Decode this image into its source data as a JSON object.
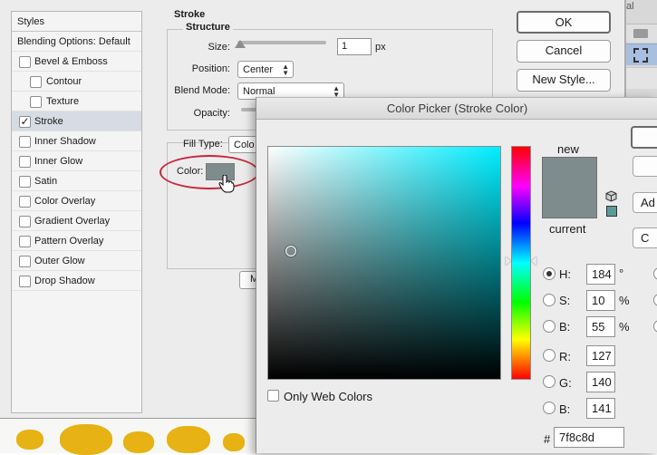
{
  "styles_panel": {
    "header": "Styles",
    "blending_options": "Blending Options: Default",
    "items": [
      {
        "label": "Bevel & Emboss",
        "checked": false,
        "indent": false,
        "selected": false
      },
      {
        "label": "Contour",
        "checked": false,
        "indent": true,
        "selected": false
      },
      {
        "label": "Texture",
        "checked": false,
        "indent": true,
        "selected": false
      },
      {
        "label": "Stroke",
        "checked": true,
        "indent": false,
        "selected": true
      },
      {
        "label": "Inner Shadow",
        "checked": false,
        "indent": false,
        "selected": false
      },
      {
        "label": "Inner Glow",
        "checked": false,
        "indent": false,
        "selected": false
      },
      {
        "label": "Satin",
        "checked": false,
        "indent": false,
        "selected": false
      },
      {
        "label": "Color Overlay",
        "checked": false,
        "indent": false,
        "selected": false
      },
      {
        "label": "Gradient Overlay",
        "checked": false,
        "indent": false,
        "selected": false
      },
      {
        "label": "Pattern Overlay",
        "checked": false,
        "indent": false,
        "selected": false
      },
      {
        "label": "Outer Glow",
        "checked": false,
        "indent": false,
        "selected": false
      },
      {
        "label": "Drop Shadow",
        "checked": false,
        "indent": false,
        "selected": false
      }
    ]
  },
  "stroke": {
    "title": "Stroke",
    "structure_title": "Structure",
    "size_label": "Size:",
    "size_value": "1",
    "size_unit": "px",
    "position_label": "Position:",
    "position_value": "Center",
    "blend_mode_label": "Blend Mode:",
    "blend_mode_value": "Normal",
    "opacity_label": "Opacity:",
    "fill_type_label": "Fill Type:",
    "fill_type_value": "Colo",
    "color_label": "Color:",
    "color_swatch": "#7f8c8d",
    "annotation_color": "#c8283a",
    "partial_button": "M"
  },
  "dialog_buttons": {
    "ok": "OK",
    "cancel": "Cancel",
    "new_style": "New Style..."
  },
  "side_panel": {
    "partial_text": "al"
  },
  "color_picker": {
    "title": "Color Picker (Stroke Color)",
    "new_label": "new",
    "current_label": "current",
    "new_color": "#7f8c8d",
    "current_color": "#7f8c8d",
    "web_swatch": "#5c9a9a",
    "only_web_colors": "Only Web Colors",
    "hue_color": "#00eeff",
    "fields": {
      "h": {
        "label": "H:",
        "value": "184",
        "unit": "°",
        "selected": true
      },
      "s": {
        "label": "S:",
        "value": "10",
        "unit": "%",
        "selected": false
      },
      "b": {
        "label": "B:",
        "value": "55",
        "unit": "%",
        "selected": false
      },
      "r": {
        "label": "R:",
        "value": "127",
        "unit": "",
        "selected": false
      },
      "g": {
        "label": "G:",
        "value": "140",
        "unit": "",
        "selected": false
      },
      "b2": {
        "label": "B:",
        "value": "141",
        "unit": "",
        "selected": false
      }
    },
    "hex_label": "#",
    "hex_value": "7f8c8d",
    "right_buttons": [
      "",
      "",
      "Ad",
      "C"
    ]
  }
}
